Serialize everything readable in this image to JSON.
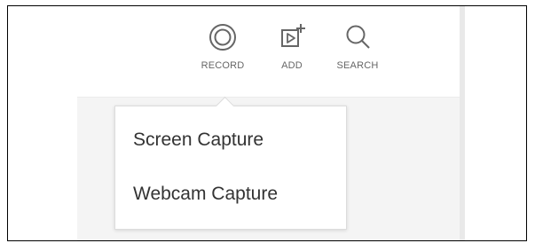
{
  "toolbar": {
    "record": {
      "label": "RECORD",
      "icon": "record-icon"
    },
    "add": {
      "label": "ADD",
      "icon": "add-media-icon"
    },
    "search": {
      "label": "SEARCH",
      "icon": "search-icon"
    }
  },
  "record_menu": {
    "items": [
      {
        "label": "Screen Capture"
      },
      {
        "label": "Webcam Capture"
      }
    ]
  },
  "colors": {
    "icon": "#666666",
    "label": "#666666",
    "menu_text": "#333333",
    "border": "#000000"
  }
}
